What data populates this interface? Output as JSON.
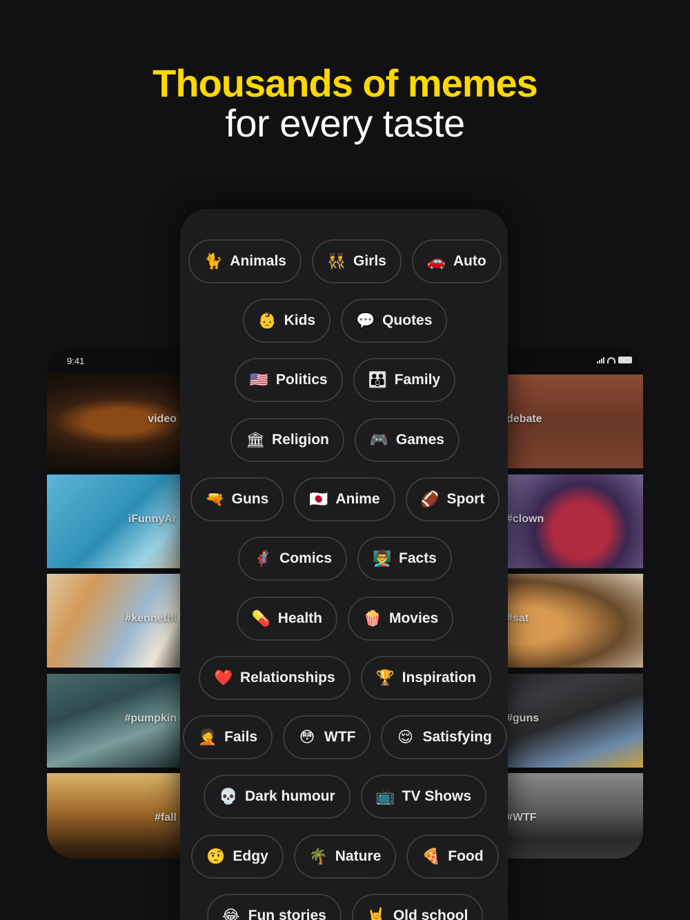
{
  "headline": {
    "line1": "Thousands of memes",
    "line2": "for every taste"
  },
  "left_phone": {
    "time": "9:41",
    "tags": [
      "video",
      "iFunnyAr",
      "#kennethl",
      "#pumpkin",
      "#fall"
    ]
  },
  "right_phone": {
    "tags": [
      "debate",
      "#clown",
      "#sat",
      "#guns",
      "#WTF"
    ]
  },
  "categories": [
    [
      {
        "emoji": "🐈",
        "label": "Animals"
      },
      {
        "emoji": "👯",
        "label": "Girls"
      },
      {
        "emoji": "🚗",
        "label": "Auto"
      }
    ],
    [
      {
        "emoji": "👶",
        "label": "Kids"
      },
      {
        "emoji": "💬",
        "label": "Quotes"
      }
    ],
    [
      {
        "emoji": "🇺🇸",
        "label": "Politics"
      },
      {
        "emoji": "👪",
        "label": "Family"
      }
    ],
    [
      {
        "emoji": "🏛",
        "label": "Religion"
      },
      {
        "emoji": "🎮",
        "label": "Games"
      }
    ],
    [
      {
        "emoji": "🔫",
        "label": "Guns"
      },
      {
        "emoji": "🇯🇵",
        "label": "Anime"
      },
      {
        "emoji": "🏈",
        "label": "Sport"
      }
    ],
    [
      {
        "emoji": "🦸",
        "label": "Comics"
      },
      {
        "emoji": "👨‍🏫",
        "label": "Facts"
      }
    ],
    [
      {
        "emoji": "💊",
        "label": "Health"
      },
      {
        "emoji": "🍿",
        "label": "Movies"
      }
    ],
    [
      {
        "emoji": "❤️",
        "label": "Relationships"
      },
      {
        "emoji": "🏆",
        "label": "Inspiration"
      }
    ],
    [
      {
        "emoji": "🤦",
        "label": "Fails"
      },
      {
        "emoji": "😳",
        "label": "WTF"
      },
      {
        "emoji": "😌",
        "label": "Satisfying"
      }
    ],
    [
      {
        "emoji": "💀",
        "label": "Dark humour"
      },
      {
        "emoji": "📺",
        "label": "TV Shows"
      }
    ],
    [
      {
        "emoji": "🤨",
        "label": "Edgy"
      },
      {
        "emoji": "🌴",
        "label": "Nature"
      },
      {
        "emoji": "🍕",
        "label": "Food"
      }
    ],
    [
      {
        "emoji": "😂",
        "label": "Fun stories"
      },
      {
        "emoji": "🤘",
        "label": "Old school"
      }
    ]
  ]
}
